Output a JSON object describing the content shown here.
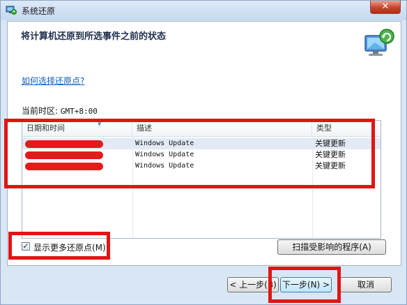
{
  "window": {
    "title": "系统还原",
    "close_glyph": "✕"
  },
  "header": {
    "title": "将计算机还原到所选事件之前的状态"
  },
  "help_link": "如何选择还原点?",
  "timezone": {
    "label": "当前时区:",
    "value": "GMT+8:00"
  },
  "list": {
    "columns": [
      "日期和时间",
      "描述",
      "类型"
    ],
    "rows": [
      {
        "date": "",
        "description": "Windows Update",
        "type": "关键更新",
        "selected": true
      },
      {
        "date": "",
        "description": "Windows Update",
        "type": "关键更新",
        "selected": false
      },
      {
        "date": "",
        "description": "Windows Update",
        "type": "关键更新",
        "selected": false
      }
    ]
  },
  "show_more": {
    "label": "显示更多还原点(M)",
    "checked": true,
    "check_glyph": "✓"
  },
  "buttons": {
    "scan": "扫描受影响的程序(A)",
    "back": "< 上一步(B)",
    "next": "下一步(N) >",
    "cancel": "取消"
  },
  "colors": {
    "annotation": "#e01515",
    "redaction": "#e41b1b",
    "link": "#0f5fbf"
  }
}
